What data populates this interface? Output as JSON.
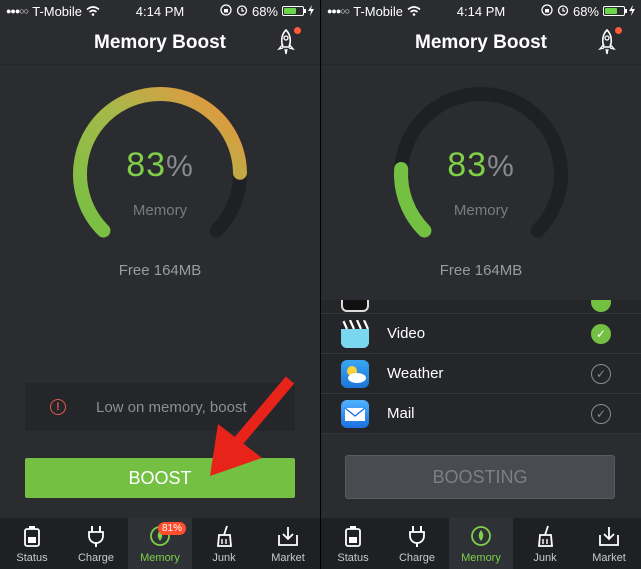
{
  "status_bar": {
    "carrier": "T-Mobile",
    "time": "4:14 PM",
    "battery_pct": "68%"
  },
  "header": {
    "title": "Memory Boost"
  },
  "gauge": {
    "percent": "83",
    "percent_symbol": "%",
    "label": "Memory",
    "free_text": "Free 164MB",
    "fill_fraction": 0.83
  },
  "left": {
    "alert_text": "Low on memory, boost",
    "boost_label": "BOOST"
  },
  "right": {
    "gauge_fill_fraction": 0.18,
    "apps": [
      {
        "name": "Video",
        "checked": true
      },
      {
        "name": "Weather",
        "checked": false
      },
      {
        "name": "Mail",
        "checked": false
      }
    ],
    "boosting_label": "BOOSTING"
  },
  "tabs": [
    {
      "label": "Status",
      "icon": "battery-icon"
    },
    {
      "label": "Charge",
      "icon": "plug-icon"
    },
    {
      "label": "Memory",
      "icon": "memory-icon"
    },
    {
      "label": "Junk",
      "icon": "broom-icon"
    },
    {
      "label": "Market",
      "icon": "download-icon"
    }
  ],
  "memory_badge": "81%",
  "colors": {
    "accent_green": "#74c043",
    "gauge_orange": "#f0903c",
    "badge_red": "#ff4d2e",
    "arrow_red": "#e8231a"
  }
}
